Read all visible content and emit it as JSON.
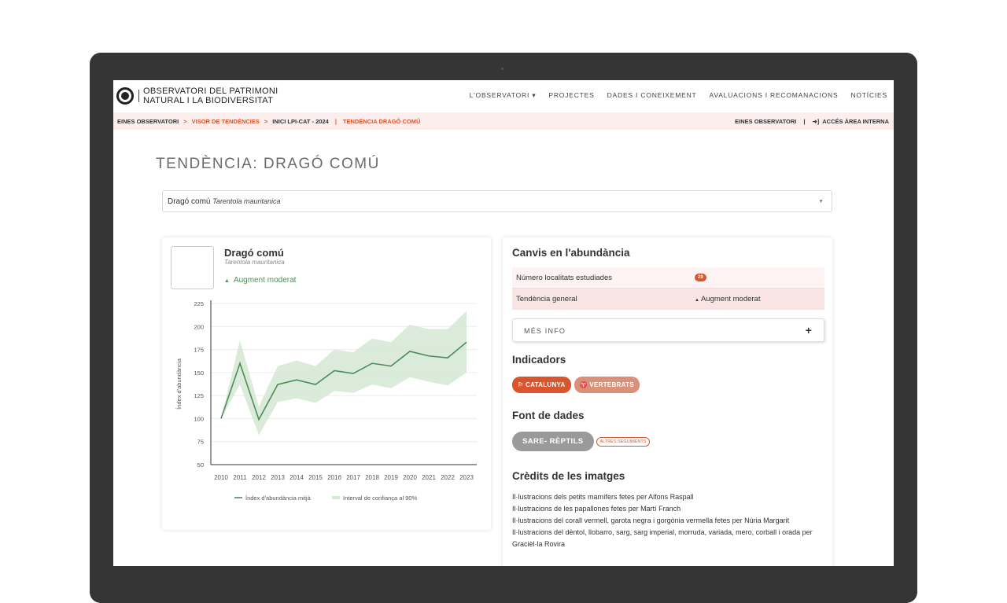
{
  "header": {
    "logo_line1": "OBSERVATORI DEL PATRIMONI",
    "logo_line2": "NATURAL I LA BIODIVERSITAT",
    "nav": [
      "L'OBSERVATORI ▾",
      "PROJECTES",
      "DADES I CONEIXEMENT",
      "AVALUACIONS I RECOMANACIONS",
      "NOTÍCIES"
    ]
  },
  "breadcrumb": {
    "items": [
      "EINES OBSERVATORI",
      "VISOR DE TENDÈNCIES",
      "INICI LPI-CAT - 2024",
      "TENDÈNCIA DRAGÓ COMÚ"
    ],
    "right_link": "EINES OBSERVATORI",
    "right_access": "ACCÉS ÀREA INTERNA"
  },
  "page": {
    "title": "TENDÈNCIA: DRAGÓ COMÚ"
  },
  "select": {
    "common": "Dragó comú",
    "scientific": "Tarentola mauritanica"
  },
  "species": {
    "name": "Dragó comú",
    "scientific": "Tarentola mauritanica",
    "trend": "Augment moderat"
  },
  "chart_data": {
    "type": "line",
    "x": [
      2010,
      2011,
      2012,
      2013,
      2014,
      2015,
      2016,
      2017,
      2018,
      2019,
      2020,
      2021,
      2022,
      2023
    ],
    "series": [
      {
        "name": "Índex d'abundància mitjà",
        "values": [
          100,
          160,
          99,
          137,
          142,
          137,
          152,
          149,
          160,
          157,
          173,
          168,
          166,
          183
        ]
      },
      {
        "name": "Interval de confiança al 90%",
        "lower": [
          100,
          137,
          82,
          118,
          122,
          117,
          130,
          128,
          137,
          133,
          145,
          140,
          136,
          150
        ],
        "upper": [
          100,
          185,
          113,
          157,
          163,
          157,
          175,
          172,
          187,
          183,
          202,
          197,
          197,
          217
        ]
      }
    ],
    "ylabel": "Índex d'abundància",
    "ylim": [
      50,
      225
    ],
    "yticks": [
      50,
      75,
      100,
      125,
      150,
      175,
      200,
      225
    ],
    "grid": true,
    "legend": "bottom",
    "colors": {
      "line": "#4d8c5a",
      "band": "#d4e8d2"
    }
  },
  "abundance": {
    "title": "Canvis en l'abundància",
    "localities_label": "Número localitats estudiades",
    "localities_value": "29",
    "trend_label": "Tendència general",
    "trend_value": "Augment moderat",
    "more_info": "MÉS INFO"
  },
  "indicators": {
    "title": "Indicadors",
    "chips": [
      "CATALUNYA",
      "VERTEBRATS"
    ]
  },
  "sources": {
    "title": "Font de dades",
    "main": "SARE- RÈPTILS",
    "other": "ALTRES SEGUIMENTS"
  },
  "credits": {
    "title": "Crèdits de les imatges",
    "lines": [
      "Il·lustracions dels petits mamífers fetes per Alfons Raspall",
      "Il·lustracions de les papallones fetes per Martí Franch",
      "Il·lustracions del corall vermell, garota negra i gorgònia vermella fetes per Núria Margarit",
      "Il·lustracions del dèntol, llobarro, sarg, sarg imperial, morruda, variada, mero, corball i orada per Gracièl·la Rovira"
    ]
  }
}
